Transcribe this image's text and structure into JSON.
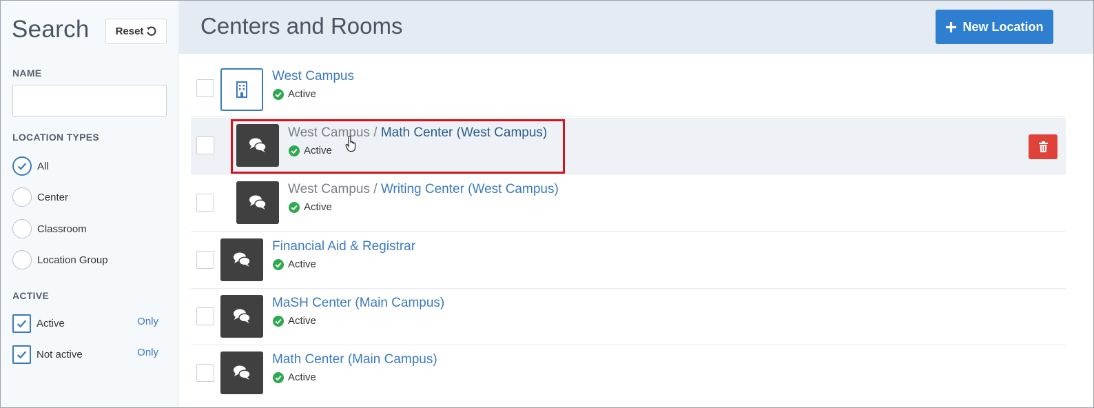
{
  "sidebar": {
    "search_title": "Search",
    "reset_label": "Reset",
    "name_label": "NAME",
    "name_value": "",
    "location_types_label": "LOCATION TYPES",
    "location_types": [
      {
        "label": "All",
        "selected": true
      },
      {
        "label": "Center",
        "selected": false
      },
      {
        "label": "Classroom",
        "selected": false
      },
      {
        "label": "Location Group",
        "selected": false
      }
    ],
    "active_label": "ACTIVE",
    "active_filters": [
      {
        "label": "Active",
        "checked": true,
        "only": "Only"
      },
      {
        "label": "Not active",
        "checked": true,
        "only": "Only"
      }
    ]
  },
  "header": {
    "title": "Centers and Rooms",
    "new_button_label": "New Location"
  },
  "locations": [
    {
      "parent": "",
      "name": "West Campus",
      "status": "Active",
      "icon": "building-icon"
    },
    {
      "parent": "West Campus",
      "name": "Math Center (West Campus)",
      "status": "Active",
      "icon": "chat-bubbles-icon"
    },
    {
      "parent": "West Campus",
      "name": "Writing Center (West Campus)",
      "status": "Active",
      "icon": "chat-bubbles-icon"
    },
    {
      "parent": "",
      "name": "Financial Aid & Registrar",
      "status": "Active",
      "icon": "chat-bubbles-icon"
    },
    {
      "parent": "",
      "name": "MaSH Center (Main Campus)",
      "status": "Active",
      "icon": "chat-bubbles-icon"
    },
    {
      "parent": "",
      "name": "Math Center (Main Campus)",
      "status": "Active",
      "icon": "chat-bubbles-icon"
    }
  ],
  "separator": "/",
  "colors": {
    "accent": "#3a79c0",
    "primary_button": "#2f7fd1",
    "danger": "#e0423a",
    "success": "#2fa84f",
    "highlight_box": "#d3141c"
  }
}
